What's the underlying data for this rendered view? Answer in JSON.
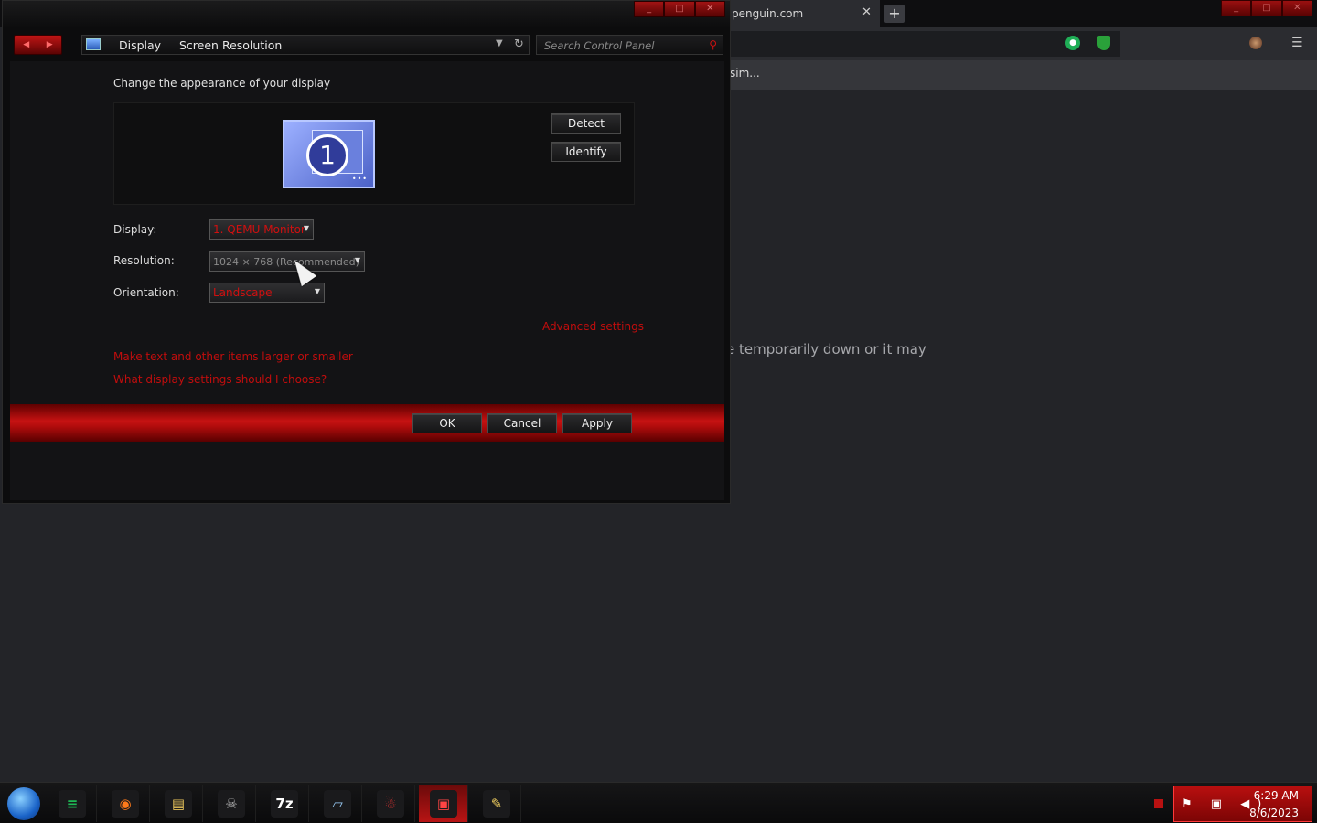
{
  "browser": {
    "tab_title": "penguin.com",
    "tab_close": "✕",
    "new_tab": "+",
    "bookmark": "sim...",
    "error_fragment": "e temporarily down or it may",
    "window_controls": [
      "_",
      "□",
      "✕"
    ]
  },
  "control_panel": {
    "window_controls": [
      "_",
      "□",
      "✕"
    ],
    "nav": {
      "back": "◀",
      "forward": "▶"
    },
    "breadcrumb": [
      "Display",
      "Screen Resolution"
    ],
    "search_placeholder": "Search Control Panel",
    "heading": "Change the appearance of your display",
    "monitor_number": "1",
    "detect_label": "Detect",
    "identify_label": "Identify",
    "display_label": "Display:",
    "display_value": "1. QEMU Monitor",
    "resolution_label": "Resolution:",
    "resolution_value": "1024 × 768 (Recommended)",
    "orientation_label": "Orientation:",
    "orientation_value": "Landscape",
    "advanced_link": "Advanced settings",
    "text_size_link": "Make text and other items larger or smaller",
    "help_link": "What display settings should I choose?",
    "ok_label": "OK",
    "cancel_label": "Cancel",
    "apply_label": "Apply"
  },
  "taskbar": {
    "items": [
      {
        "name": "taskbar-notes",
        "glyph": "≡",
        "color": "#1db954"
      },
      {
        "name": "taskbar-firefox",
        "glyph": "◉",
        "color": "#ff7a1a"
      },
      {
        "name": "taskbar-file-explorer",
        "glyph": "▤",
        "color": "#e8c35a"
      },
      {
        "name": "taskbar-skull-app",
        "glyph": "☠",
        "color": "#bbbbbb"
      },
      {
        "name": "taskbar-7zip",
        "glyph": "7z",
        "color": "#ffffff"
      },
      {
        "name": "taskbar-notepad",
        "glyph": "▱",
        "color": "#9fd3ff"
      },
      {
        "name": "taskbar-santa-app",
        "glyph": "☃",
        "color": "#dd3333"
      },
      {
        "name": "taskbar-display-settings",
        "glyph": "▣",
        "color": "#ff4444"
      },
      {
        "name": "taskbar-paint",
        "glyph": "✎",
        "color": "#f2d060"
      }
    ],
    "clock_time": "6:29 AM",
    "clock_date": "8/6/2023"
  }
}
